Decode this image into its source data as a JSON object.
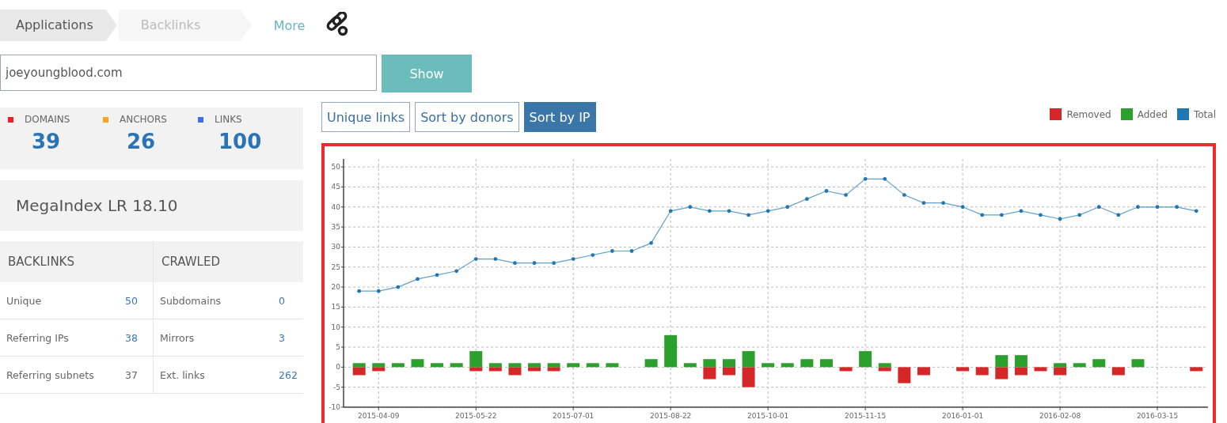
{
  "breadcrumbs": [
    {
      "label": "Applications",
      "disabled": false
    },
    {
      "label": "Backlinks",
      "disabled": true
    }
  ],
  "more_link": "More",
  "search": {
    "value": "joeyoungblood.com",
    "button": "Show"
  },
  "stats": [
    {
      "label": "DOMAINS",
      "value": "39",
      "color": "#e8202a"
    },
    {
      "label": "ANCHORS",
      "value": "26",
      "color": "#f5a623"
    },
    {
      "label": "LINKS",
      "value": "100",
      "color": "#3d6fe0"
    }
  ],
  "index_rating": "MegaIndex LR 18.10",
  "tables": [
    {
      "title": "BACKLINKS",
      "rows": [
        {
          "label": "Unique",
          "value": "50",
          "link": true
        },
        {
          "label": "Referring IPs",
          "value": "38",
          "link": true
        },
        {
          "label": "Referring subnets",
          "value": "37",
          "link": false
        }
      ]
    },
    {
      "title": "CRAWLED",
      "rows": [
        {
          "label": "Subdomains",
          "value": "0",
          "link": true
        },
        {
          "label": "Mirrors",
          "value": "3",
          "link": true
        },
        {
          "label": "Ext. links",
          "value": "262",
          "link": true
        }
      ]
    }
  ],
  "view_tabs": [
    {
      "label": "Unique links",
      "selected": false
    },
    {
      "label": "Sort by donors",
      "selected": false
    },
    {
      "label": "Sort by IP",
      "selected": true
    }
  ],
  "chart": {
    "chart_data": {
      "type": "bar",
      "stacked": true,
      "grid": true,
      "categories": [
        null,
        "2015-04-09",
        null,
        null,
        null,
        null,
        "2015-05-22",
        null,
        null,
        null,
        null,
        "2015-07-01",
        null,
        null,
        null,
        null,
        "2015-08-22",
        null,
        null,
        null,
        null,
        "2015-10-01",
        null,
        null,
        null,
        null,
        "2015-11-15",
        null,
        null,
        null,
        null,
        "2016-01-01",
        null,
        null,
        null,
        null,
        "2016-02-08",
        null,
        null,
        null,
        null,
        "2016-03-15",
        null,
        null
      ],
      "ylim": [
        -10,
        52
      ],
      "yticks": [
        -10,
        -5,
        0,
        5,
        10,
        15,
        20,
        25,
        30,
        35,
        40,
        45,
        50
      ],
      "series": [
        {
          "name": "Removed",
          "color": "#d62728",
          "type": "bar",
          "values": [
            -2,
            -1,
            null,
            null,
            null,
            null,
            -1,
            -1,
            -2,
            -1,
            -1,
            null,
            null,
            null,
            null,
            null,
            null,
            null,
            -3,
            -2,
            -5,
            null,
            null,
            null,
            null,
            -1,
            null,
            -1,
            -4,
            -2,
            null,
            -1,
            -2,
            -3,
            -2,
            -1,
            -2,
            null,
            null,
            -2,
            null,
            null,
            null,
            -1
          ]
        },
        {
          "name": "Added",
          "color": "#2ca02c",
          "type": "bar",
          "values": [
            1,
            1,
            1,
            2,
            1,
            1,
            4,
            1,
            1,
            1,
            1,
            1,
            1,
            1,
            null,
            2,
            8,
            1,
            2,
            2,
            4,
            1,
            1,
            2,
            2,
            null,
            4,
            1,
            null,
            null,
            null,
            null,
            null,
            3,
            3,
            null,
            1,
            1,
            2,
            null,
            2,
            null,
            null,
            null
          ]
        },
        {
          "name": "Total",
          "color": "#1f77b4",
          "type": "line",
          "values": [
            19,
            19,
            20,
            22,
            23,
            24,
            27,
            27,
            26,
            26,
            26,
            27,
            28,
            29,
            29,
            31,
            39,
            40,
            39,
            39,
            38,
            39,
            40,
            42,
            44,
            43,
            47,
            47,
            43,
            41,
            41,
            40,
            38,
            38,
            39,
            38,
            37,
            38,
            40,
            38,
            40,
            40,
            40,
            39
          ]
        }
      ]
    }
  }
}
